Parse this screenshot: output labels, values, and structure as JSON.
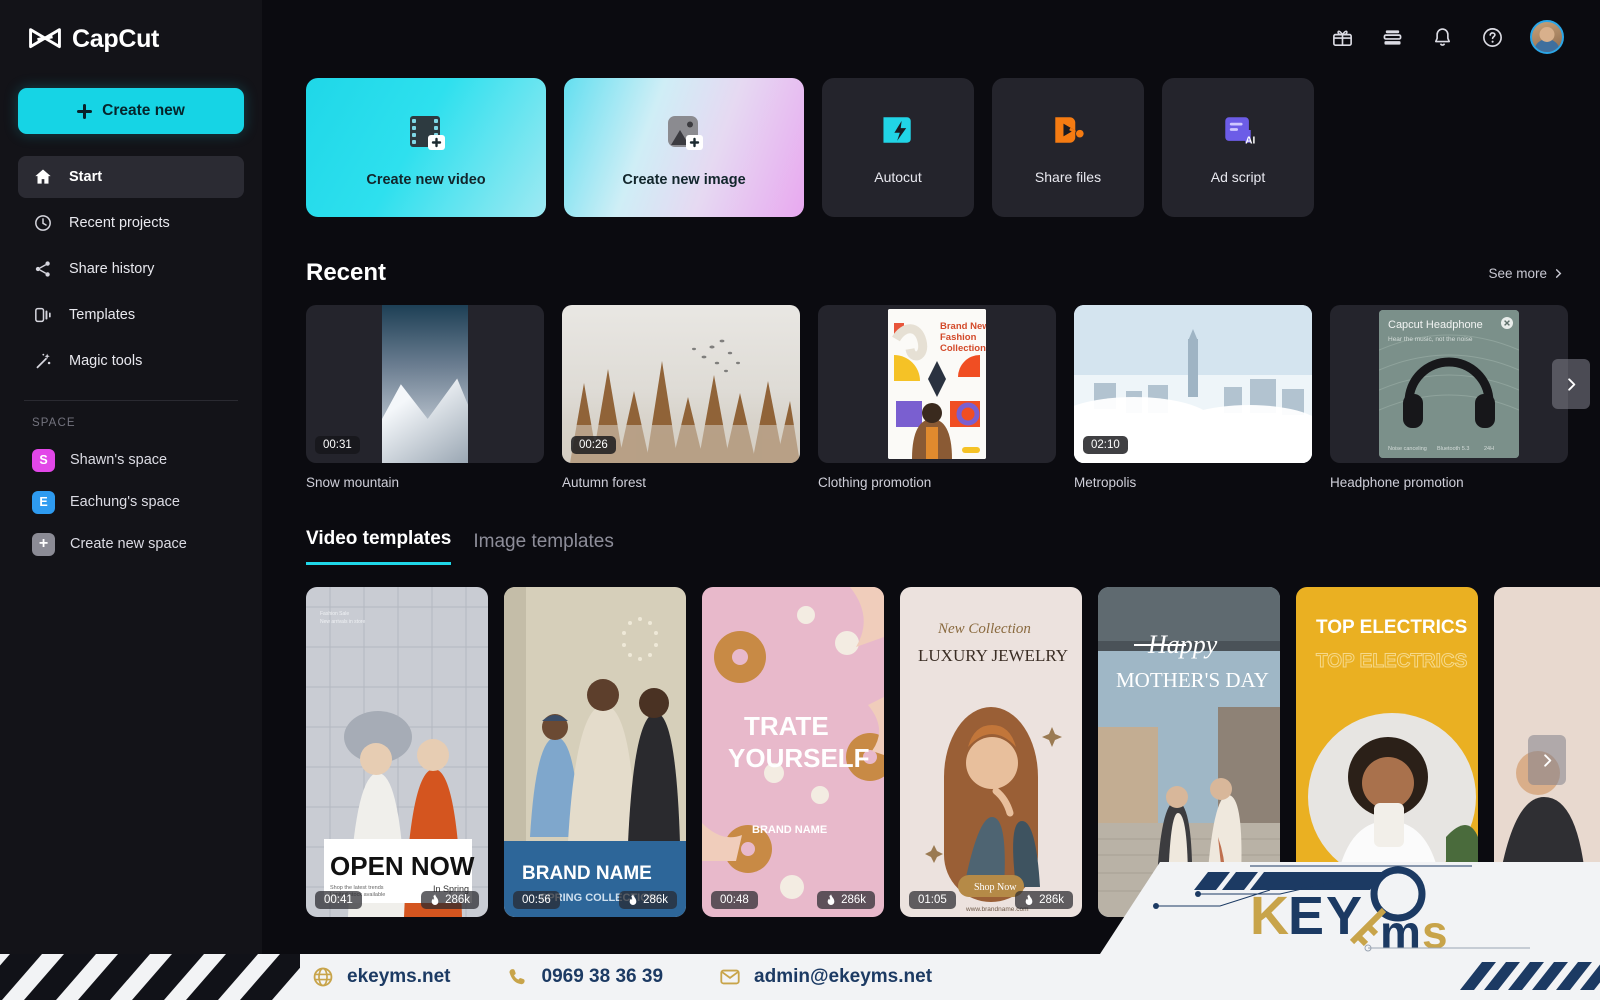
{
  "brand": {
    "name": "CapCut",
    "logo_icon": "capcut-logo-icon"
  },
  "sidebar": {
    "create_new": {
      "label": "Create new",
      "icon": "plus-icon"
    },
    "nav": [
      {
        "label": "Start",
        "icon": "home-icon",
        "active": true
      },
      {
        "label": "Recent projects",
        "icon": "clock-icon",
        "active": false
      },
      {
        "label": "Share history",
        "icon": "share-icon",
        "active": false
      },
      {
        "label": "Templates",
        "icon": "templates-icon",
        "active": false
      },
      {
        "label": "Magic tools",
        "icon": "magic-wand-icon",
        "active": false
      }
    ],
    "space_heading": "SPACE",
    "spaces": [
      {
        "label": "Shawn's space",
        "initial": "S",
        "color": "#E247E8"
      },
      {
        "label": "Eachung's space",
        "initial": "E",
        "color": "#2E9BF0"
      },
      {
        "label": "Create new space",
        "initial": "+",
        "color": "#8b8b95"
      }
    ]
  },
  "header": {
    "icons": [
      {
        "name": "gift-icon"
      },
      {
        "name": "wallet-icon"
      },
      {
        "name": "notification-bell-icon"
      },
      {
        "name": "help-icon"
      }
    ],
    "avatar_name": "user-avatar"
  },
  "actions": [
    {
      "label": "Create new video",
      "icon": "film-plus-icon",
      "style": "video"
    },
    {
      "label": "Create new image",
      "icon": "image-plus-icon",
      "style": "image"
    },
    {
      "label": "Autocut",
      "icon": "autocut-icon",
      "style": "plain",
      "accent": "#21D4E6"
    },
    {
      "label": "Share files",
      "icon": "share-files-icon",
      "style": "plain",
      "accent": "#F57B12"
    },
    {
      "label": "Ad script",
      "icon": "ad-script-ai-icon",
      "style": "plain",
      "accent": "#6C5CE7"
    }
  ],
  "recent": {
    "title": "Recent",
    "see_more": "See more",
    "items": [
      {
        "name": "Snow mountain",
        "duration": "00:31",
        "art": "snow"
      },
      {
        "name": "Autumn forest",
        "duration": "00:26",
        "art": "forest"
      },
      {
        "name": "Clothing promotion",
        "duration": "",
        "art": "clothing",
        "poster_lines": [
          "Brand New",
          "Fashion",
          "Collection."
        ]
      },
      {
        "name": "Metropolis",
        "duration": "02:10",
        "art": "metro"
      },
      {
        "name": "Headphone promotion",
        "duration": "",
        "art": "headphone",
        "poster_title": "Capcut Headphone",
        "poster_sub": "Hear the music, not the noise",
        "poster_specs": [
          "Noise canceling",
          "Bluetooth 5.3",
          "24H"
        ]
      }
    ],
    "next_icon": "chevron-right-icon"
  },
  "templates": {
    "tabs": [
      {
        "label": "Video templates",
        "active": true
      },
      {
        "label": "Image templates",
        "active": false
      }
    ],
    "next_icon": "chevron-right-icon",
    "cards": [
      {
        "art": "openNow",
        "duration": "00:41",
        "uses": "286k",
        "headline": "OPEN NOW",
        "sub": "In Spring"
      },
      {
        "art": "brandName",
        "duration": "00:56",
        "uses": "286k",
        "headline": "BRAND NAME",
        "sub": "SPRING COLLECTION"
      },
      {
        "art": "treat",
        "duration": "00:48",
        "uses": "286k",
        "headline": "TRATE YOURSELF",
        "sub": "BRAND NAME"
      },
      {
        "art": "jewelry",
        "duration": "01:05",
        "uses": "286k",
        "headline": "LUXURY JEWELRY",
        "script": "New Collection",
        "cta": "Shop Now"
      },
      {
        "art": "mothers",
        "duration": "",
        "uses": "",
        "headline": "MOTHER'S DAY",
        "script": "Happy"
      },
      {
        "art": "electrics",
        "duration": "",
        "uses": "",
        "headline": "TOP ELECTRICS",
        "sub": "TOP ELECTRICS"
      },
      {
        "art": "partial",
        "duration": "",
        "uses": ""
      }
    ],
    "fire_icon": "flame-icon"
  },
  "footer": {
    "items": [
      {
        "icon": "globe-icon",
        "text": "ekeyms.net"
      },
      {
        "icon": "phone-icon",
        "text": "0969 38 36 39"
      },
      {
        "icon": "mail-icon",
        "text": "admin@ekeyms.net"
      }
    ]
  },
  "watermark": {
    "text_key": "KEY",
    "text_ms": "ms",
    "name": "keyms-logo"
  },
  "colors": {
    "accent_cyan": "#1FD7E8",
    "bg_dark": "#0B0B10",
    "sidebar": "#131318",
    "card": "#24242C",
    "footer_navy": "#1C3A63",
    "footer_gold": "#C8A44A"
  }
}
